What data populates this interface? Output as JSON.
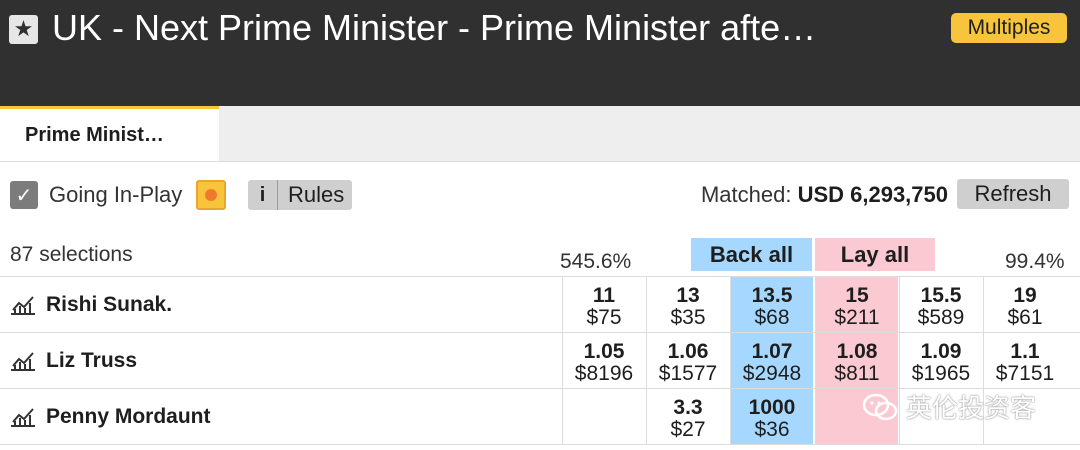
{
  "header": {
    "star_icon": "star-icon",
    "title": "UK - Next Prime Minister - Prime Minister afte…",
    "multiples_label": "Multiples"
  },
  "tabs": [
    {
      "label": "Prime Minist…",
      "active": true
    }
  ],
  "controls": {
    "going_in_play_label": "Going In-Play",
    "going_in_play_checked": true,
    "rules_info": "i",
    "rules_label": "Rules",
    "matched_label": "Matched:",
    "matched_value": "USD 6,293,750",
    "refresh_label": "Refresh"
  },
  "market": {
    "selections_count": "87 selections",
    "back_overround": "545.6%",
    "lay_overround": "99.4%",
    "back_all_label": "Back all",
    "lay_all_label": "Lay all"
  },
  "runners": [
    {
      "name": "Rishi Sunak.",
      "prices": [
        {
          "odds": "11",
          "amount": "$75",
          "side": "back"
        },
        {
          "odds": "13",
          "amount": "$35",
          "side": "back"
        },
        {
          "odds": "13.5",
          "amount": "$68",
          "side": "back-best"
        },
        {
          "odds": "15",
          "amount": "$211",
          "side": "lay-best"
        },
        {
          "odds": "15.5",
          "amount": "$589",
          "side": "lay"
        },
        {
          "odds": "19",
          "amount": "$61",
          "side": "lay"
        }
      ]
    },
    {
      "name": "Liz Truss",
      "prices": [
        {
          "odds": "1.05",
          "amount": "$8196",
          "side": "back"
        },
        {
          "odds": "1.06",
          "amount": "$1577",
          "side": "back"
        },
        {
          "odds": "1.07",
          "amount": "$2948",
          "side": "back-best"
        },
        {
          "odds": "1.08",
          "amount": "$811",
          "side": "lay-best"
        },
        {
          "odds": "1.09",
          "amount": "$1965",
          "side": "lay"
        },
        {
          "odds": "1.1",
          "amount": "$7151",
          "side": "lay"
        }
      ]
    },
    {
      "name": "Penny Mordaunt",
      "prices": [
        {
          "odds": "",
          "amount": "",
          "side": "back"
        },
        {
          "odds": "3.3",
          "amount": "$27",
          "side": "back"
        },
        {
          "odds": "1000",
          "amount": "$36",
          "side": "back-best"
        },
        {
          "odds": "",
          "amount": "",
          "side": "lay-best"
        },
        {
          "odds": "",
          "amount": "",
          "side": "lay"
        },
        {
          "odds": "",
          "amount": "",
          "side": "lay"
        }
      ]
    }
  ],
  "watermark": {
    "icon": "wechat-icon",
    "text": "英伦投资客"
  },
  "colors": {
    "topbar": "#303030",
    "accent": "#f7c43c",
    "back": "#a6d8ff",
    "lay": "#fac9d1"
  }
}
